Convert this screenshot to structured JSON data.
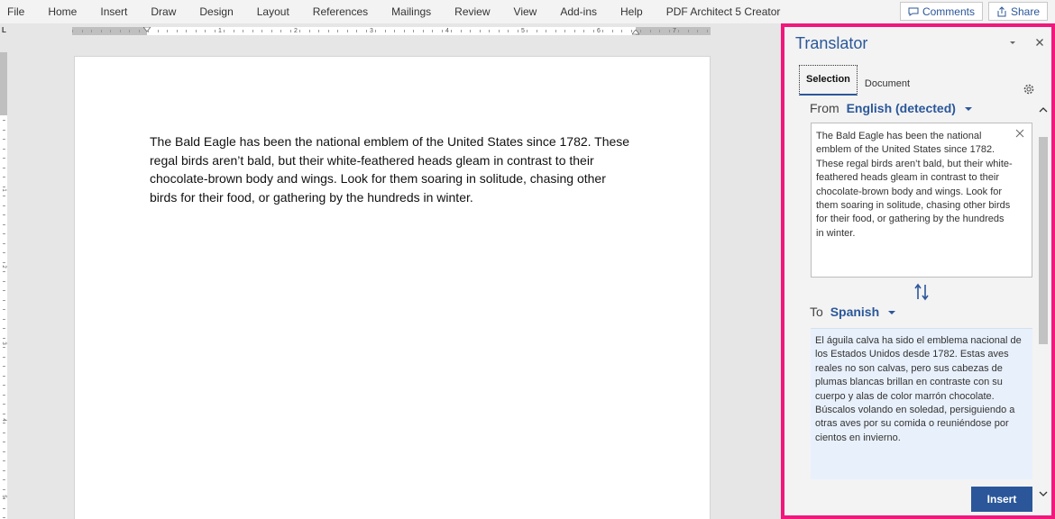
{
  "ribbon": {
    "menu": [
      "File",
      "Home",
      "Insert",
      "Draw",
      "Design",
      "Layout",
      "References",
      "Mailings",
      "Review",
      "View",
      "Add-ins",
      "Help",
      "PDF Architect 5 Creator"
    ],
    "comments_label": "Comments",
    "share_label": "Share",
    "comments_icon": "comment-icon",
    "share_icon": "share-icon",
    "accent": "#2b579a"
  },
  "document": {
    "tab_stop": "L",
    "ruler_numbers": [
      "1",
      "2",
      "3",
      "4",
      "5",
      "6",
      "7"
    ],
    "vruler_numbers": [
      "1",
      "2",
      "3",
      "4",
      "5"
    ],
    "paragraph": "The Bald Eagle has been the national emblem of the United States since 1782. These regal birds aren’t bald, but their white-feathered heads gleam in contrast to their chocolate-brown body and wings. Look for them soaring in solitude, chasing other birds for their food, or gathering by the hundreds in winter."
  },
  "translator": {
    "title": "Translator",
    "tabs": [
      {
        "label": "Selection",
        "active": true
      },
      {
        "label": "Document",
        "active": false
      }
    ],
    "from_label": "From",
    "from_language": "English (detected)",
    "source_text": "The Bald Eagle has been the national emblem of the United States since 1782. These regal birds aren’t bald, but their white-feathered heads gleam in contrast to their chocolate-brown body and wings. Look for them soaring in solitude, chasing other birds for their food, or gathering by the hundreds in winter.",
    "to_label": "To",
    "to_language": "Spanish",
    "translated_text": "El águila calva ha sido el emblema nacional de los Estados Unidos desde 1782. Estas aves reales no son calvas, pero sus cabezas de plumas blancas brillan en contraste con su cuerpo y alas de color marrón chocolate. Búscalos volando en soledad, persiguiendo a otras aves por su comida o reuniéndose por cientos en invierno.",
    "insert_label": "Insert",
    "highlight_color": "#f0187c",
    "icons": [
      "chevron-down-icon",
      "close-icon",
      "gear-icon",
      "swap-icon",
      "clear-icon"
    ]
  }
}
